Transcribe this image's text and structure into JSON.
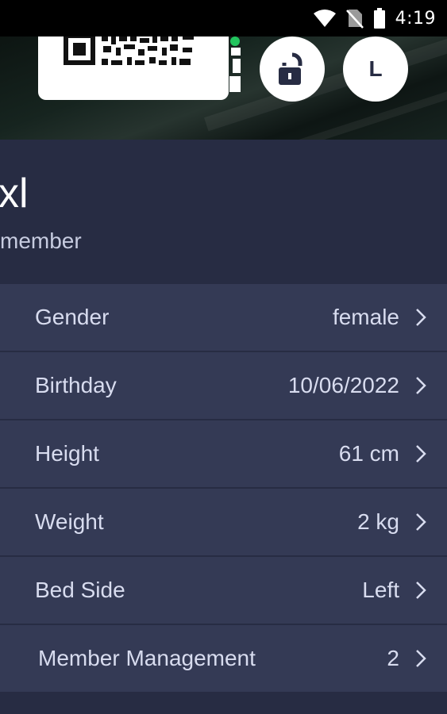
{
  "status_bar": {
    "time": "4:19",
    "icons": [
      "wifi-icon",
      "no-sim-icon",
      "battery-icon"
    ]
  },
  "header": {
    "qr_icon": "qr-code-icon",
    "lock_icon": "unlock-icon",
    "avatar_letter": "L"
  },
  "profile": {
    "name": "xl",
    "role": "member"
  },
  "settings": [
    {
      "label": "Gender",
      "value": "female"
    },
    {
      "label": "Birthday",
      "value": "10/06/2022"
    },
    {
      "label": "Height",
      "value": "61 cm"
    },
    {
      "label": "Weight",
      "value": "2 kg"
    },
    {
      "label": "Bed Side",
      "value": "Left"
    },
    {
      "label": "Member Management",
      "value": "2"
    }
  ],
  "colors": {
    "background": "#272c43",
    "row": "#343a55",
    "online_dot": "#22c55e"
  }
}
